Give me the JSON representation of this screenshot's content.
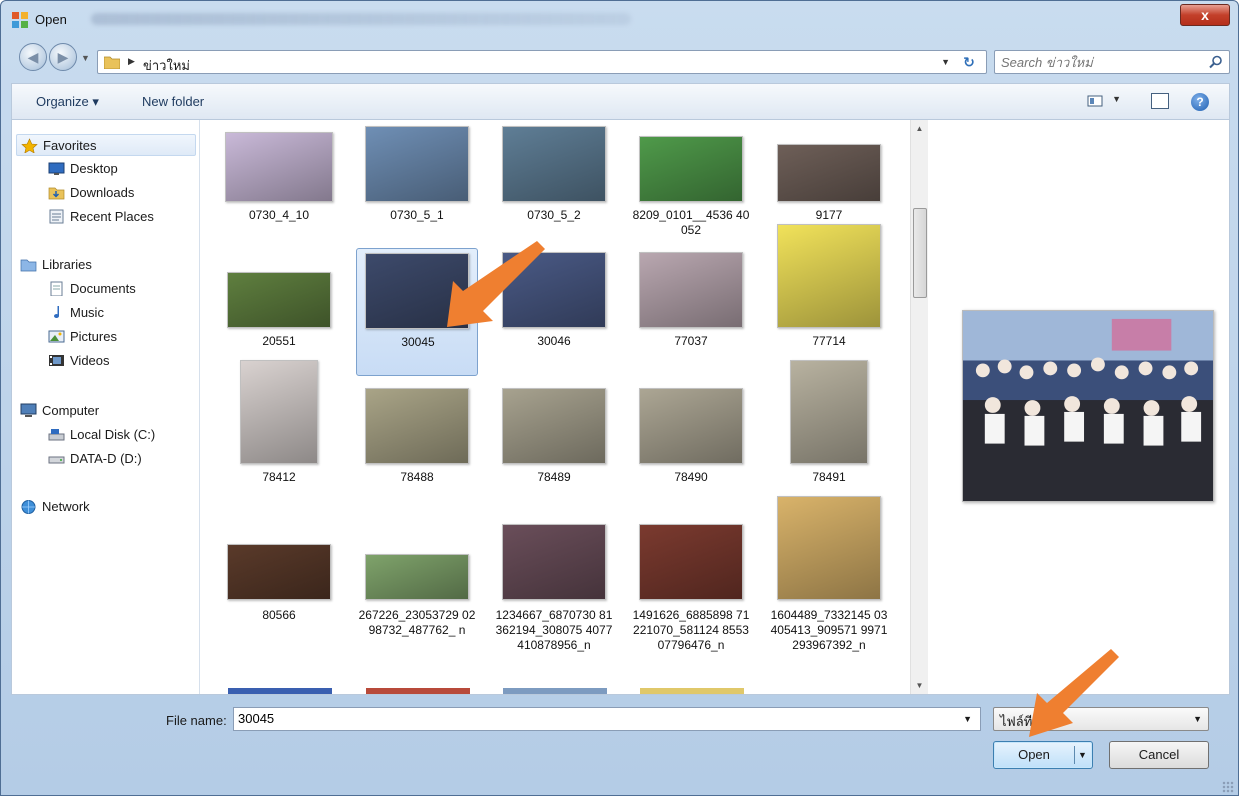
{
  "window": {
    "title": "Open",
    "close_label": "x"
  },
  "address": {
    "crumb": "ข่าวใหม่",
    "search_placeholder": "Search ข่าวใหม่"
  },
  "toolbar": {
    "organize_label": "Organize ▾",
    "newfolder_label": "New folder"
  },
  "nav": {
    "items": [
      {
        "label": "Favorites",
        "icon": "star-icon"
      },
      {
        "label": "Desktop",
        "icon": "desktop-icon"
      },
      {
        "label": "Downloads",
        "icon": "downloads-icon"
      },
      {
        "label": "Recent Places",
        "icon": "recent-places-icon"
      },
      {
        "label": "Libraries",
        "icon": "libraries-icon"
      },
      {
        "label": "Documents",
        "icon": "documents-icon"
      },
      {
        "label": "Music",
        "icon": "music-icon"
      },
      {
        "label": "Pictures",
        "icon": "pictures-icon"
      },
      {
        "label": "Videos",
        "icon": "videos-icon"
      },
      {
        "label": "Computer",
        "icon": "computer-icon"
      },
      {
        "label": "Local Disk (C:)",
        "icon": "disk-icon"
      },
      {
        "label": "DATA-D (D:)",
        "icon": "drive-icon"
      },
      {
        "label": "Network",
        "icon": "network-icon"
      }
    ]
  },
  "files": [
    {
      "name": "0730_4_10",
      "color": "#c9b9d8"
    },
    {
      "name": "0730_5_1",
      "color": "#6f8fb5"
    },
    {
      "name": "0730_5_2",
      "color": "#5f7e96"
    },
    {
      "name": "8209_0101__4536 40052",
      "color": "#4f9a4a"
    },
    {
      "name": "9177",
      "color": "#6e5f58"
    },
    {
      "name": "20551",
      "color": "#5f7f3f"
    },
    {
      "name": "30045",
      "color": "#3d4a6b"
    },
    {
      "name": "30046",
      "color": "#4a5a86"
    },
    {
      "name": "77037",
      "color": "#b9a7b0"
    },
    {
      "name": "77714",
      "color": "#f1e25a"
    },
    {
      "name": "78412",
      "color": "#d9d2d0"
    },
    {
      "name": "78488",
      "color": "#a9a487"
    },
    {
      "name": "78489",
      "color": "#a7a28f"
    },
    {
      "name": "78490",
      "color": "#aca694"
    },
    {
      "name": "78491",
      "color": "#b8b2a0"
    },
    {
      "name": "80566",
      "color": "#5a3a2a"
    },
    {
      "name": "267226_23053729 0298732_487762_ n",
      "color": "#7fa36b"
    },
    {
      "name": "1234667_6870730 81362194_308075 4077410878956_n",
      "color": "#6a4e5a"
    },
    {
      "name": "1491626_6885898 71221070_581124 855307796476_n",
      "color": "#7b3a2f"
    },
    {
      "name": "1604489_7332145 03405413_909571 9971293967392_n",
      "color": "#d9b36a"
    }
  ],
  "bottom": {
    "filename_label": "File name:",
    "filename_value": "30045",
    "filetype_value": "ไฟล์ที",
    "open_label": "Open",
    "cancel_label": "Cancel"
  },
  "colors": {
    "accent_arrow": "#ef7f30",
    "selection": "#c8dcf5"
  }
}
